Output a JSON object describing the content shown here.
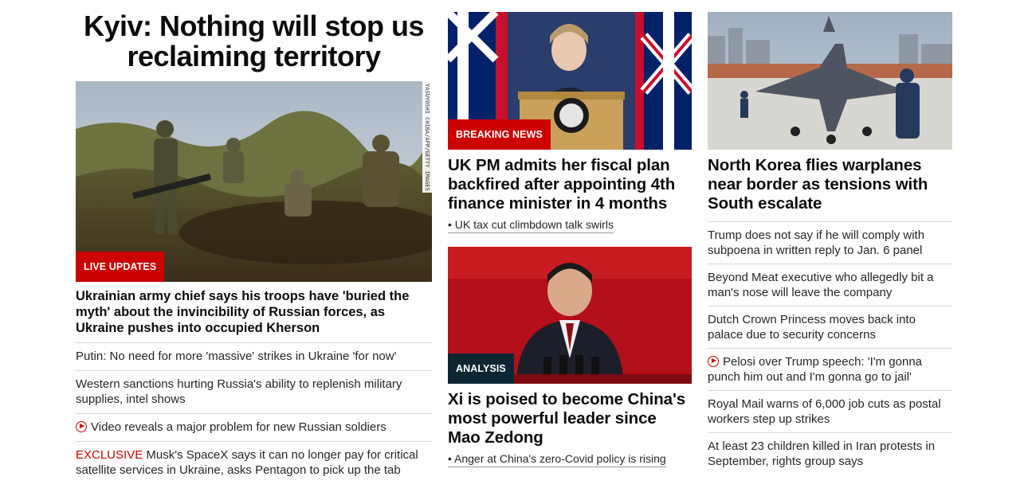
{
  "column_left": {
    "headline": "Kyiv: Nothing will stop us reclaiming territory",
    "image_credit": "YASUYOSHI CHIBA/AFP/GETTY IMAGES",
    "badge": "LIVE UPDATES",
    "lead_story": "Ukrainian army chief says his troops have 'buried the myth' about the invincibility of Russian forces, as Ukraine pushes into occupied Kherson",
    "links": [
      {
        "text": "Putin: No need for more 'massive' strikes in Ukraine 'for now'"
      },
      {
        "text": "Western sanctions hurting Russia's ability to replenish military supplies, intel shows"
      },
      {
        "text": "Video reveals a major problem for new Russian soldiers",
        "icon": "play-icon"
      },
      {
        "prefix": "EXCLUSIVE",
        "text": " Musk's SpaceX says it can no longer pay for critical satellite services in Ukraine, asks Pentagon to pick up the tab"
      }
    ]
  },
  "column_middle": {
    "story1": {
      "badge": "BREAKING NEWS",
      "headline": "UK PM admits her fiscal plan backfired after appointing 4th finance minister in 4 months",
      "sublink": "• UK tax cut climbdown talk swirls"
    },
    "story2": {
      "badge": "ANALYSIS",
      "headline": "Xi is poised to become China's most powerful leader since Mao Zedong",
      "sublink": "• Anger at China's zero-Covid policy is rising"
    }
  },
  "column_right": {
    "headline": "North Korea flies warplanes near border as tensions with South escalate",
    "links": [
      {
        "text": "Trump does not say if he will comply with subpoena in written reply to Jan. 6 panel"
      },
      {
        "text": "Beyond Meat executive who allegedly bit a man's nose will leave the company"
      },
      {
        "text": "Dutch Crown Princess moves back into palace due to security concerns"
      },
      {
        "text": "Pelosi over Trump speech: 'I'm gonna punch him out and I'm gonna go to jail'",
        "icon": "play-icon"
      },
      {
        "text": "Royal Mail warns of 6,000 job cuts as postal workers step up strikes"
      },
      {
        "text": "At least 23 children killed in Iran protests in September, rights group says"
      }
    ]
  },
  "colors": {
    "accent_red": "#cc0000",
    "analysis_navy": "#0c2733",
    "text": "#0c0c0c"
  }
}
